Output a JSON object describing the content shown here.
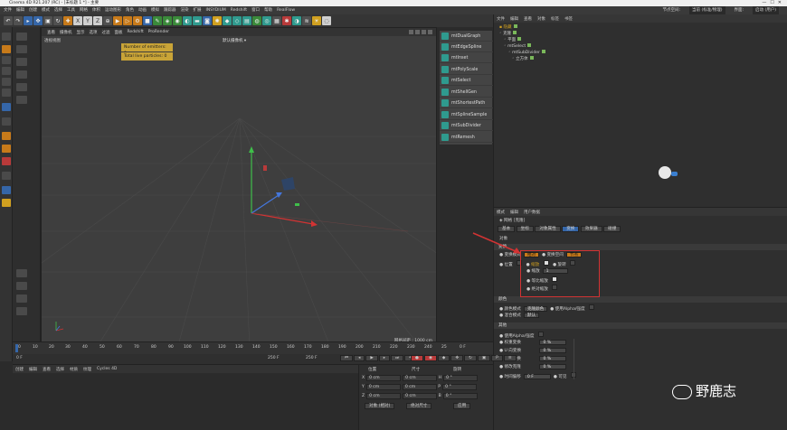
{
  "window": {
    "title": "Cinema 4D R21.207 (RC) - [未标题 1 *] - 主要"
  },
  "menubar": {
    "items": [
      "文件",
      "编辑",
      "创建",
      "模式",
      "选择",
      "工具",
      "网格",
      "体积",
      "运动图形",
      "角色",
      "动画",
      "模拟",
      "跟踪器",
      "渲染",
      "扩展",
      "INSYDIUM",
      "Redshift",
      "窗口",
      "帮助",
      "RealFlow"
    ],
    "right": [
      "节点空间:",
      "当前 (标准/物理)",
      "界面:",
      "启动 (用户)"
    ]
  },
  "viewport": {
    "menu": [
      "查看",
      "摄像机",
      "显示",
      "选项",
      "过滤",
      "面板",
      "Redshift",
      "ProRender"
    ],
    "label": "透视视图",
    "camera": "默认摄像机 ▾",
    "hud": [
      "Number of emitters: 0",
      "Total live particles: 0"
    ],
    "grid_distance": "网格间距 : 1000 cm"
  },
  "popup_menu": {
    "items": [
      "mtDualGraph",
      "mtEdgeSpline",
      "mtInset",
      "mtPolyScale",
      "mtSelect",
      "mtShellGen",
      "mtShortestPath",
      "mtSplineSample",
      "mtSubDivider",
      "mtRemesh"
    ]
  },
  "object_panel": {
    "menu": [
      "文件",
      "编辑",
      "查看",
      "对象",
      "标签",
      "书签"
    ],
    "rows": [
      "隐藏",
      "克隆",
      "平面",
      "mtSelect",
      "mtSubDivider",
      "立方体"
    ]
  },
  "attributes": {
    "menu": [
      "模式",
      "编辑",
      "用户数据"
    ],
    "object_title": "网格 [克隆]",
    "tabs": [
      "基本",
      "坐标",
      "对象属性",
      "变换",
      "效果器",
      "碰撞"
    ],
    "object_section": "对象",
    "sections": {
      "transform": "变换",
      "color": "颜色",
      "other": "其他"
    },
    "rows": {
      "mode_label": "变换模式",
      "mode_value": "相对",
      "space_label": "变换空间",
      "space_value": "节点",
      "position": "位置",
      "scale": "缩放",
      "rotate": "旋转",
      "scale_amount_label": "缩放",
      "scale_amount_value": "1",
      "uniform_scale": "等比缩放",
      "absolute_scale": "绝对缩放",
      "color_mode_label": "颜色模式",
      "color_mode_value": "克隆颜色",
      "use_alpha": "使用Alpha/强度",
      "blend_mode_label": "混合模式",
      "blend_mode_value": "默认",
      "other_use_alpha": "使用Alpha/强度",
      "weight": "权重变换",
      "u_trans": "U 向变换",
      "v_trans": "V 向变换",
      "modify_clone": "修改克隆",
      "time_offset": "时间偏移",
      "percent": "0 %",
      "time_value": "0 F",
      "visible": "可见"
    }
  },
  "timeline": {
    "ticks": [
      "0",
      "10",
      "20",
      "30",
      "40",
      "50",
      "60",
      "70",
      "80",
      "90",
      "100",
      "110",
      "120",
      "130",
      "140",
      "150",
      "160",
      "170",
      "180",
      "190",
      "200",
      "210",
      "220",
      "230",
      "240",
      "25"
    ],
    "current_frame": "0 F",
    "start": "0 F",
    "end_1": "250 F",
    "end_2": "250 F"
  },
  "material_panel": {
    "menu": [
      "创建",
      "编辑",
      "查看",
      "选择",
      "材质",
      "纹理",
      "Cycles 4D"
    ]
  },
  "coordinates": {
    "headers": [
      "位置",
      "尺寸",
      "旋转"
    ],
    "rows": [
      {
        "axis": "X",
        "pos": "0 cm",
        "size": "0 cm",
        "rot_label": "H",
        "rot": "0 °"
      },
      {
        "axis": "Y",
        "pos": "0 cm",
        "size": "0 cm",
        "rot_label": "P",
        "rot": "0 °"
      },
      {
        "axis": "Z",
        "pos": "0 cm",
        "size": "0 cm",
        "rot_label": "B",
        "rot": "0 °"
      }
    ],
    "mode": "对象 (相对)",
    "size_mode": "绝对尺寸",
    "apply": "应用"
  },
  "watermark": {
    "text": "野鹿志"
  }
}
